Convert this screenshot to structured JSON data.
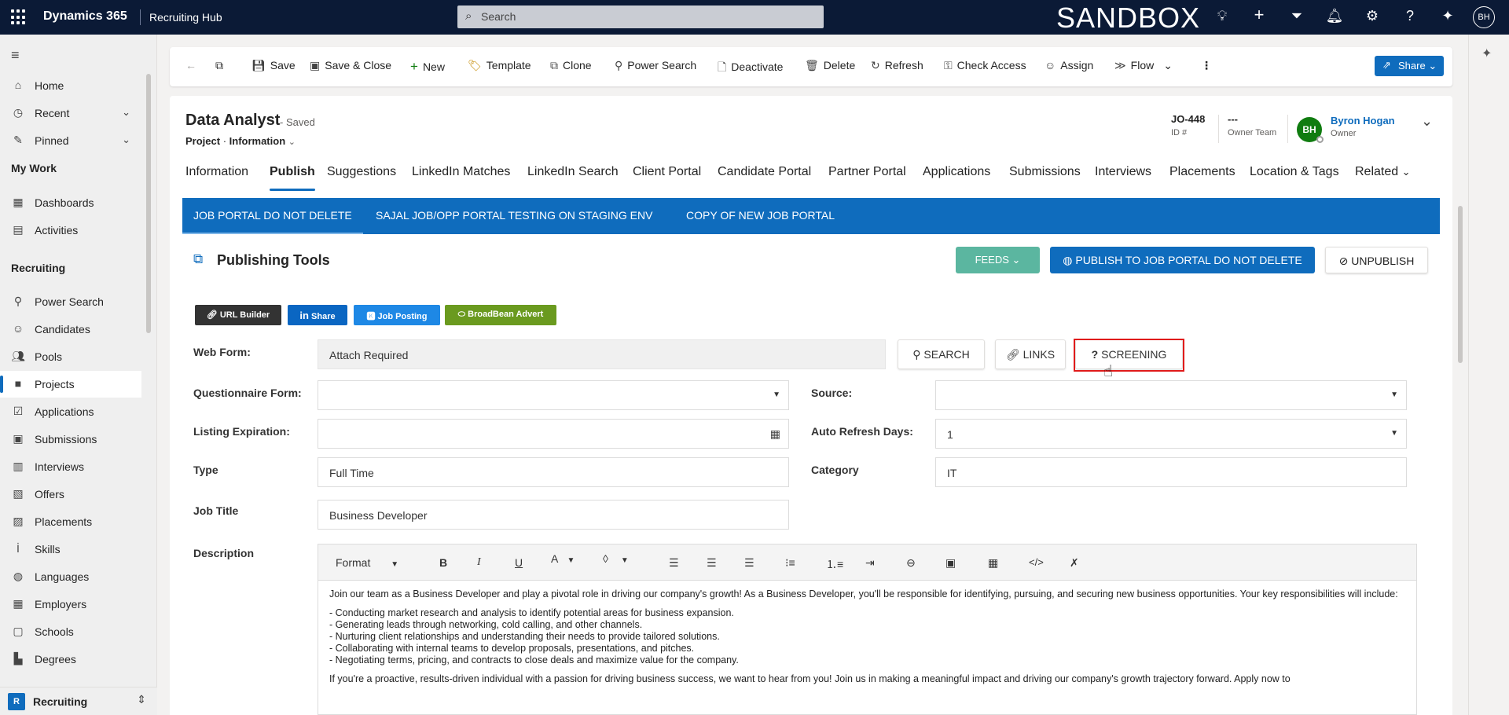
{
  "topbar": {
    "app_name": "Dynamics 365",
    "area_name": "Recruiting Hub",
    "search_placeholder": "Search",
    "environment": "SANDBOX",
    "avatar_initials": "BH",
    "icons": [
      "lightbulb-icon",
      "plus-icon",
      "filter-icon",
      "bell-icon",
      "gear-icon",
      "help-icon",
      "copilot-icon"
    ]
  },
  "sidebar": {
    "items_top": [
      {
        "label": "Home",
        "icon": "home-icon"
      },
      {
        "label": "Recent",
        "icon": "clock-icon"
      },
      {
        "label": "Pinned",
        "icon": "pin-icon"
      }
    ],
    "my_work_header": "My Work",
    "my_work": [
      {
        "label": "Dashboards",
        "icon": "dashboard-icon"
      },
      {
        "label": "Activities",
        "icon": "clipboard-icon"
      }
    ],
    "recruiting_header": "Recruiting",
    "recruiting": [
      {
        "label": "Power Search",
        "icon": "search-icon"
      },
      {
        "label": "Candidates",
        "icon": "person-icon"
      },
      {
        "label": "Pools",
        "icon": "people-icon"
      },
      {
        "label": "Projects",
        "icon": "briefcase-icon"
      },
      {
        "label": "Applications",
        "icon": "check-doc-icon"
      },
      {
        "label": "Submissions",
        "icon": "submission-icon"
      },
      {
        "label": "Interviews",
        "icon": "calendar-icon"
      },
      {
        "label": "Offers",
        "icon": "offer-icon"
      },
      {
        "label": "Placements",
        "icon": "placement-icon"
      },
      {
        "label": "Skills",
        "icon": "skills-icon"
      },
      {
        "label": "Languages",
        "icon": "globe-icon"
      },
      {
        "label": "Employers",
        "icon": "building-icon"
      },
      {
        "label": "Schools",
        "icon": "school-icon"
      },
      {
        "label": "Degrees",
        "icon": "degree-icon"
      }
    ],
    "area_badge": "R",
    "area_label": "Recruiting"
  },
  "commands": {
    "save": "Save",
    "save_close": "Save & Close",
    "new": "New",
    "template": "Template",
    "clone": "Clone",
    "power_search": "Power Search",
    "deactivate": "Deactivate",
    "delete": "Delete",
    "refresh": "Refresh",
    "check_access": "Check Access",
    "assign": "Assign",
    "flow": "Flow",
    "share": "Share"
  },
  "record": {
    "title": "Data Analyst",
    "saved": "- Saved",
    "entity": "Project",
    "form": "Information",
    "id_value": "JO-448",
    "id_label": "ID #",
    "team_value": "---",
    "team_label": "Owner Team",
    "owner_initials": "BH",
    "owner_name": "Byron Hogan",
    "owner_role": "Owner"
  },
  "tabs": [
    "Information",
    "Publish",
    "Suggestions",
    "LinkedIn Matches",
    "LinkedIn Search",
    "Client Portal",
    "Candidate Portal",
    "Partner Portal",
    "Applications",
    "Submissions",
    "Interviews",
    "Placements",
    "Location & Tags",
    "Related"
  ],
  "portal_tabs": [
    "JOB PORTAL DO NOT DELETE",
    "SAJAL JOB/OPP PORTAL TESTING ON STAGING ENV",
    "COPY OF NEW JOB PORTAL"
  ],
  "publishing": {
    "title": "Publishing Tools",
    "feeds": "FEEDS",
    "publish": "PUBLISH TO JOB PORTAL DO NOT DELETE",
    "unpublish": "UNPUBLISH",
    "small_buttons": {
      "url_builder": "URL Builder",
      "share": "Share",
      "job_posting": "Job Posting",
      "broadbean": "BroadBean Advert"
    }
  },
  "form": {
    "web_form_label": "Web Form:",
    "web_form_value": "Attach Required",
    "search_btn": "SEARCH",
    "links_btn": "LINKS",
    "screening_btn": "SCREENING",
    "questionnaire_label": "Questionnaire Form:",
    "questionnaire_value": "",
    "source_label": "Source:",
    "source_value": "",
    "listing_label": "Listing Expiration:",
    "listing_value": "",
    "auto_refresh_label": "Auto Refresh Days:",
    "auto_refresh_value": "1",
    "type_label": "Type",
    "type_value": "Full Time",
    "category_label": "Category",
    "category_value": "IT",
    "job_title_label": "Job Title",
    "job_title_value": "Business Developer",
    "description_label": "Description"
  },
  "editor": {
    "format": "Format",
    "intro": "Join our team as a Business Developer and play a pivotal role in driving our company's growth! As a Business Developer, you'll be responsible for identifying, pursuing, and securing new business opportunities. Your key responsibilities will include:",
    "bullets": [
      "- Conducting market research and analysis to identify potential areas for business expansion.",
      "- Generating leads through networking, cold calling, and other channels.",
      "- Nurturing client relationships and understanding their needs to provide tailored solutions.",
      "- Collaborating with internal teams to develop proposals, presentations, and pitches.",
      "- Negotiating terms, pricing, and contracts to close deals and maximize value for the company."
    ],
    "closing": "If you're a proactive, results-driven individual with a passion for driving business success, we want to hear from you! Join us in making a meaningful impact and driving our company's growth trajectory forward. Apply now to"
  },
  "colors": {
    "topbar": "#0b1a36",
    "accent": "#0f6cbd",
    "feeds": "#5bb6a0",
    "highlight": "#e01b1b"
  }
}
